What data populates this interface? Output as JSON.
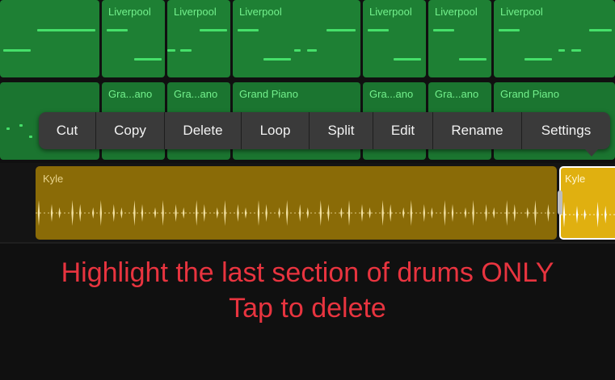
{
  "tracks": {
    "row1": {
      "labels": [
        "Liverpool",
        "Liverpool",
        "Liverpool",
        "Liverpool",
        "Liverpool",
        "Liverpool"
      ]
    },
    "row2": {
      "labels": [
        "Gra...ano",
        "Gra...ano",
        "Grand Piano",
        "Gra...ano",
        "Gra...ano",
        "Grand Piano"
      ]
    }
  },
  "context_menu": {
    "items": [
      "Cut",
      "Copy",
      "Delete",
      "Loop",
      "Split",
      "Edit",
      "Rename",
      "Settings"
    ]
  },
  "drum_track": {
    "main_region_label": "Kyle",
    "last_region_label": "Kyle"
  },
  "caption": {
    "line1": "Highlight the last section of drums ONLY",
    "line2": "Tap to delete"
  },
  "colors": {
    "midi_green": "#1e8034",
    "note_green": "#46e06a",
    "drum_region": "#8a6b07",
    "drum_selected": "#e0b010",
    "caption_red": "#e8343f",
    "menu_bg": "#3a3a3a"
  }
}
